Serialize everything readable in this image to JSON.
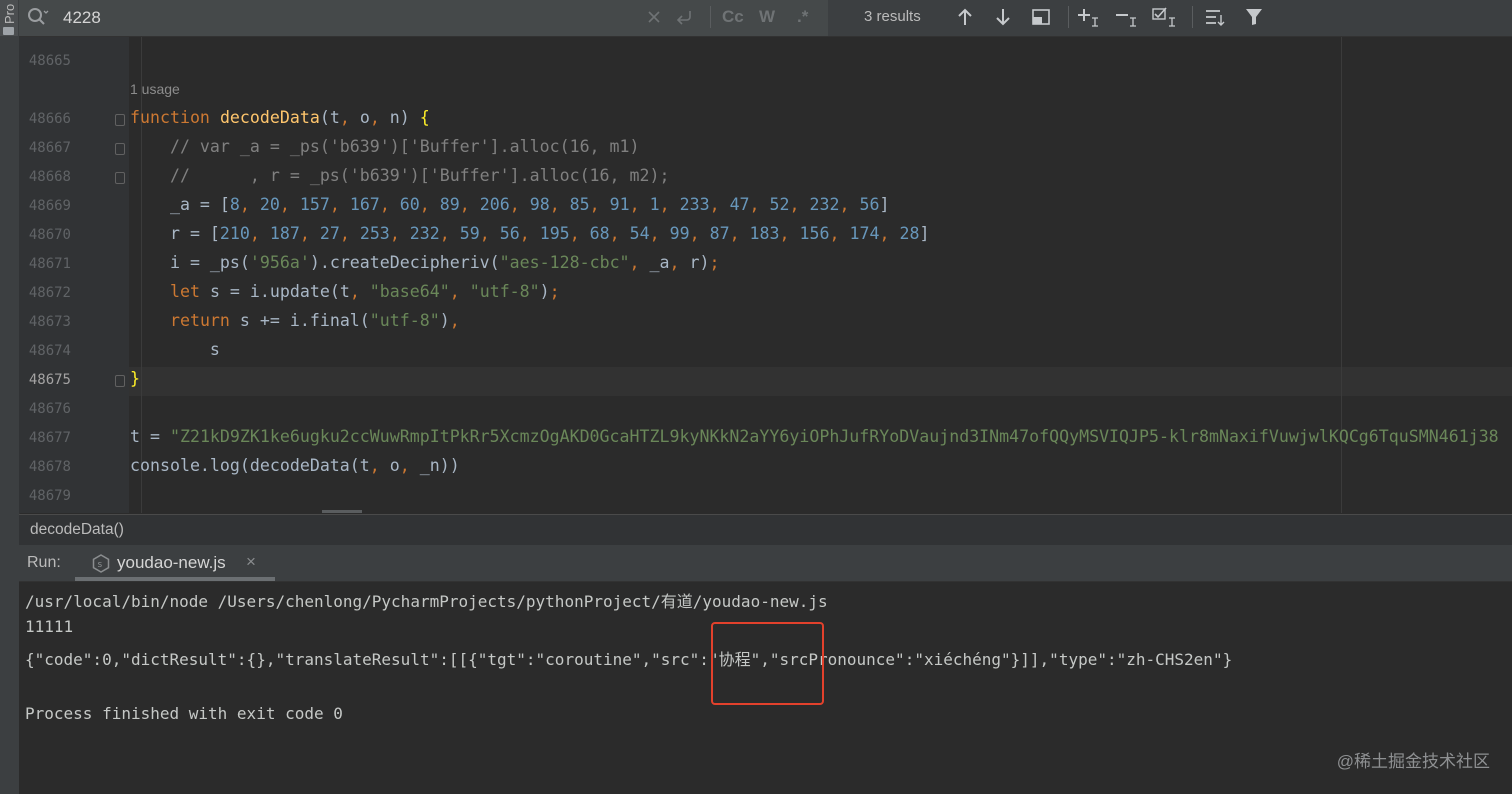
{
  "project_panel": {
    "label": "Pro"
  },
  "search": {
    "query": "4228",
    "results_count": "3 results",
    "case_label": "Cc",
    "word_label": "W",
    "regex_label": ".*"
  },
  "editor": {
    "usage_hint": "1 usage",
    "line_numbers": [
      "48665",
      "48666",
      "48667",
      "48668",
      "48669",
      "48670",
      "48671",
      "48672",
      "48673",
      "48674",
      "48675",
      "48676",
      "48677",
      "48678",
      "48679"
    ],
    "current_line": "48675",
    "code": {
      "l48666": {
        "kw": "function",
        "name": "decodeData",
        "params": "(t",
        "c1": ",",
        "p2": " o",
        "c2": ",",
        "p3": " n) ",
        "brace": "{"
      },
      "l48667": "    // var _a = _ps('b639')['Buffer'].alloc(16, m1)",
      "l48668": "    //      , r = _ps('b639')['Buffer'].alloc(16, m2);",
      "l48669": {
        "prefix": "    _a = [",
        "nums": [
          "8",
          "20",
          "157",
          "167",
          "60",
          "89",
          "206",
          "98",
          "85",
          "91",
          "1",
          "233",
          "47",
          "52",
          "232",
          "56"
        ],
        "suffix": "]"
      },
      "l48670": {
        "prefix": "    r = [",
        "nums": [
          "210",
          "187",
          "27",
          "253",
          "232",
          "59",
          "56",
          "195",
          "68",
          "54",
          "99",
          "87",
          "183",
          "156",
          "174",
          "28"
        ],
        "suffix": "]"
      },
      "l48671": {
        "a": "    i = _ps(",
        "s1": "'956a'",
        "b": ").createDecipheriv(",
        "s2": "\"aes-128-cbc\"",
        "c": ",",
        "d": " _a",
        "e": ",",
        "f": " r)",
        "g": ";"
      },
      "l48672": {
        "ind": "    ",
        "kw": "let",
        "a": " s = i.update(t",
        "c1": ",",
        "s1": " \"base64\"",
        "c2": ",",
        "s2": " \"utf-8\"",
        "b": ")",
        "g": ";"
      },
      "l48673": {
        "ind": "    ",
        "kw": "return",
        "a": " s += i.final(",
        "s1": "\"utf-8\"",
        "b": ")",
        "c": ","
      },
      "l48674": "        s",
      "l48675": "}",
      "l48677": {
        "a": "t = ",
        "s": "\"Z21kD9ZK1ke6ugku2ccWuwRmpItPkRr5XcmzOgAKD0GcaHTZL9kyNKkN2aYY6yiOPhJufRYoDVaujnd3INm47ofQQyMSVIQJP5-klr8mNaxifVuwjwlKQCg6TquSMN461j38"
      },
      "l48678": {
        "a": "console.log(decodeData(t",
        "c1": ",",
        "b": " o",
        "c2": ",",
        "d": " _n))"
      }
    }
  },
  "breadcrumb": {
    "label": "decodeData()"
  },
  "run": {
    "label": "Run:",
    "tab_title": "youdao-new.js",
    "close_glyph": "×"
  },
  "console": {
    "lines": [
      "/usr/local/bin/node /Users/chenlong/PycharmProjects/pythonProject/有道/youdao-new.js",
      "11111",
      "{\"code\":0,\"dictResult\":{},\"translateResult\":[[{\"tgt\":\"coroutine\",\"src\":\"协程\",\"srcPronounce\":\"xiéchéng\"}]],\"type\":\"zh-CHS2en\"}",
      "",
      "Process finished with exit code 0"
    ]
  },
  "watermark": "@稀土掘金技术社区",
  "colors": {
    "keyword": "#cc7832",
    "function": "#ffc66d",
    "number": "#6897bb",
    "string": "#6a8759",
    "comment": "#808080",
    "highlight": "#e2412c"
  }
}
